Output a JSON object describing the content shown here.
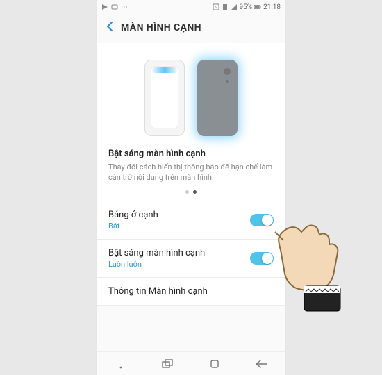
{
  "statusbar": {
    "battery_pct": "95%",
    "time": "21:18"
  },
  "header": {
    "title": "MÀN HÌNH CẠNH"
  },
  "hero": {
    "title": "Bật sáng màn hình cạnh",
    "description": "Thay đổi cách hiển thị thông báo để hạn chế làm cản trở nội dung trên màn hình.",
    "page_index": 1,
    "page_count": 2
  },
  "rows": [
    {
      "label": "Bảng ở cạnh",
      "sub": "Bật",
      "toggle": true
    },
    {
      "label": "Bật sáng màn hình cạnh",
      "sub": "Luôn luôn",
      "toggle": true
    },
    {
      "label": "Thông tin Màn hình cạnh",
      "sub": null,
      "toggle": null
    }
  ],
  "nav": {
    "recents": "recents",
    "home": "home",
    "back": "back"
  }
}
